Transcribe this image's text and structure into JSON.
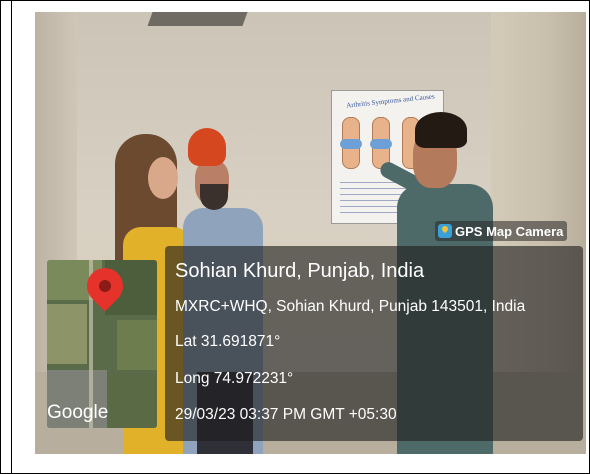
{
  "badge": {
    "label": "GPS Map Camera",
    "icon": "gps-map-camera-icon"
  },
  "location": {
    "title": "Sohian Khurd, Punjab, India",
    "address": "MXRC+WHQ, Sohian Khurd, Punjab 143501, India",
    "lat": "Lat 31.691871°",
    "long": "Long 74.972231°",
    "datetime": "29/03/23 03:37 PM GMT +05:30"
  },
  "minimap": {
    "label": "Google",
    "pin_color": "#e5322b"
  },
  "poster": {
    "title": "Arthritis Symptoms and Causes"
  },
  "colors": {
    "overlay": "#1e1e1e",
    "text": "#ffffff",
    "badge_icon": "#3aa0d8"
  }
}
